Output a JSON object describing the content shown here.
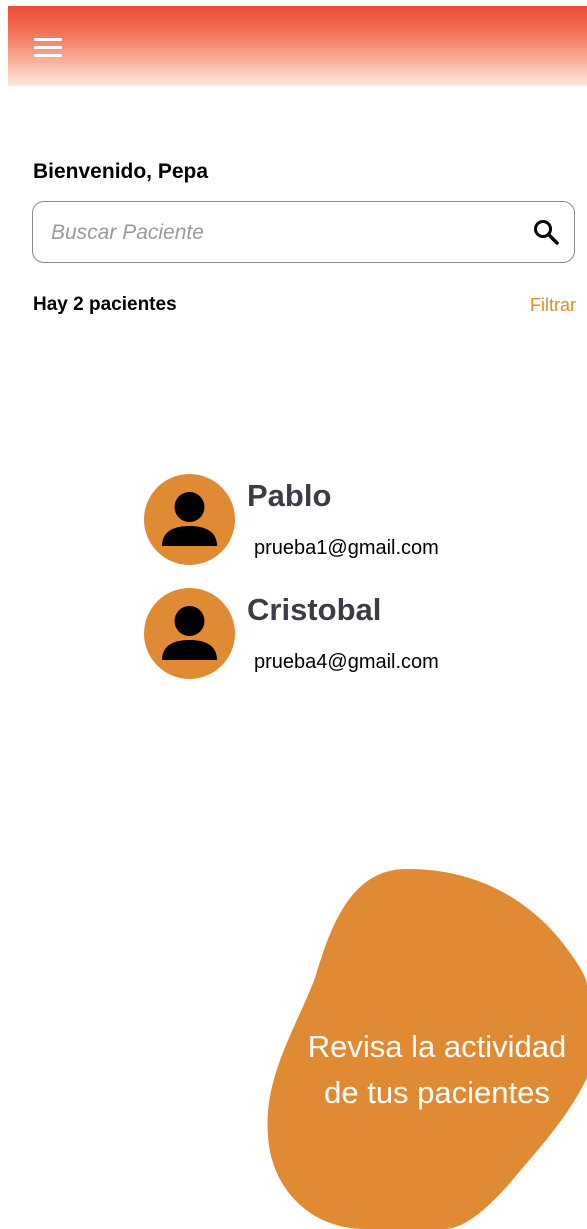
{
  "header": {
    "menu_icon": "hamburger-menu-icon",
    "gradient_colors": [
      "#ee4b3a",
      "#fde9e0"
    ]
  },
  "welcome": {
    "text": "Bienvenido, Pepa"
  },
  "search": {
    "placeholder": "Buscar Paciente",
    "value": "",
    "icon": "search-icon"
  },
  "patients_summary": {
    "count_text": "Hay 2 pacientes",
    "filter_label": "Filtrar"
  },
  "patients": [
    {
      "name": "Pablo",
      "email": "prueba1@gmail.com",
      "avatar_icon": "person-icon"
    },
    {
      "name": "Cristobal",
      "email": "prueba4@gmail.com",
      "avatar_icon": "person-icon"
    }
  ],
  "promo": {
    "line1": "Revisa la actividad",
    "line2": "de tus pacientes"
  },
  "colors": {
    "accent": "#e08a34",
    "name_text": "#3c3c47",
    "header_red": "#ee4b3a"
  }
}
